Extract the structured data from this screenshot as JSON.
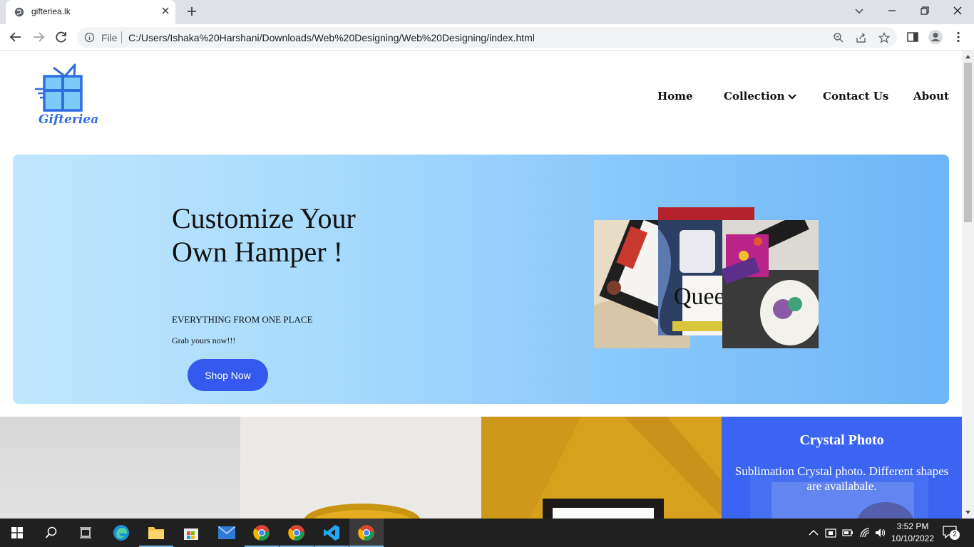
{
  "browser": {
    "tab_title": "gifteriea.lk",
    "scheme_label": "File",
    "url": "C:/Users/Ishaka%20Harshani/Downloads/Web%20Designing/Web%20Designing/index.html"
  },
  "site": {
    "logo_text": "Gifteriea",
    "nav": {
      "home": "Home",
      "collection": "Collection",
      "contact": "Contact Us",
      "about": "About"
    },
    "hero": {
      "heading": "Customize Your Own Hamper !",
      "subheading": "EVERYTHING FROM ONE PLACE",
      "tagline": "Grab yours now!!!",
      "button": "Shop Now"
    },
    "cards": [
      {
        "title": "",
        "description": ""
      },
      {
        "title": "",
        "description": ""
      },
      {
        "title": "",
        "description": ""
      },
      {
        "title": "Crystal Photo",
        "description": "Sublimation Crystal photo. Different shapes are availabale."
      }
    ]
  },
  "taskbar": {
    "time": "3:52 PM",
    "date": "10/10/2022",
    "notifications": "2"
  },
  "colors": {
    "brand_blue": "#3559ee",
    "hero_gradient_start": "#bfe6fd",
    "hero_gradient_end": "#6db6f8",
    "card_accent": "#3b64f3"
  }
}
